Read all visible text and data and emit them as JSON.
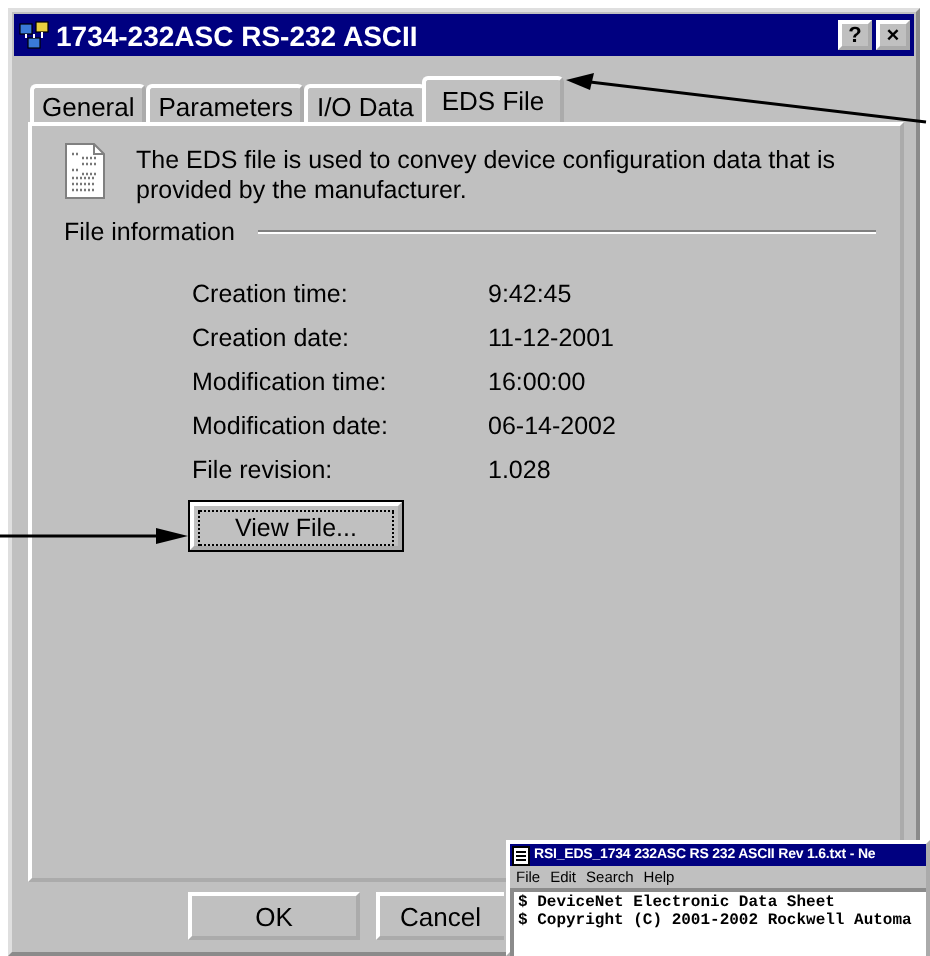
{
  "window": {
    "title": "1734-232ASC RS-232 ASCII",
    "controls": [
      "?",
      "×"
    ]
  },
  "tabs": [
    {
      "label": "General",
      "selected": false
    },
    {
      "label": "Parameters",
      "selected": false
    },
    {
      "label": "I/O Data",
      "selected": false
    },
    {
      "label": "EDS File",
      "selected": true
    }
  ],
  "description": "The EDS file is used to convey device configuration data that is provided by the manufacturer.",
  "section": "File information",
  "fields": [
    {
      "label": "Creation time:",
      "value": "9:42:45"
    },
    {
      "label": "Creation date:",
      "value": "11-12-2001"
    },
    {
      "label": "Modification time:",
      "value": "16:00:00"
    },
    {
      "label": "Modification date:",
      "value": "06-14-2002"
    },
    {
      "label": "File revision:",
      "value": "1.028"
    }
  ],
  "view_button": "View File...",
  "buttons": [
    "OK",
    "Cancel"
  ],
  "notepad": {
    "title": "RSI_EDS_1734 232ASC RS 232 ASCII Rev 1.6.txt - Ne",
    "menu": [
      "File",
      "Edit",
      "Search",
      "Help"
    ],
    "lines": [
      "$ DeviceNet Electronic Data Sheet",
      "$ Copyright (C) 2001-2002 Rockwell Automa"
    ]
  }
}
